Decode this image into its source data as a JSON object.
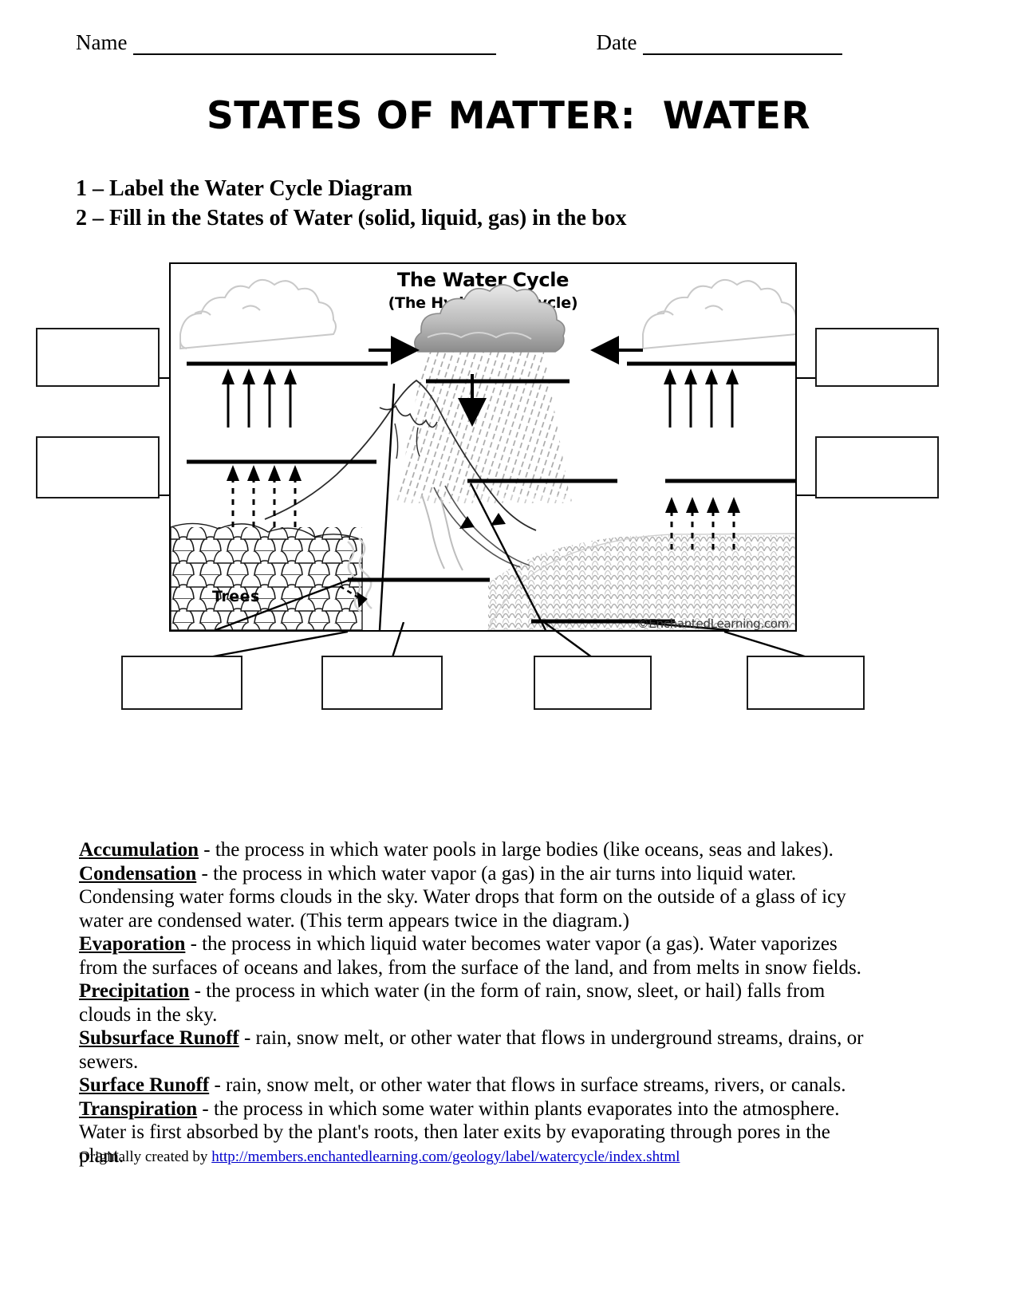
{
  "header": {
    "name_label": "Name",
    "date_label": "Date"
  },
  "title": "STATES OF MATTER:  WATER",
  "instructions": [
    "1 – Label the Water Cycle Diagram",
    "2 – Fill in the States of Water (solid, liquid, gas) in the box"
  ],
  "diagram": {
    "title": "The Water Cycle",
    "subtitle": "(The Hydrologic Cycle)",
    "trees_label": "Trees",
    "copyright": "©EnchantedLearning.com"
  },
  "answer_boxes": [
    {
      "id": "box-left-top",
      "value": ""
    },
    {
      "id": "box-left-bottom",
      "value": ""
    },
    {
      "id": "box-right-top",
      "value": ""
    },
    {
      "id": "box-right-bottom",
      "value": ""
    },
    {
      "id": "box-bottom-1",
      "value": ""
    },
    {
      "id": "box-bottom-2",
      "value": ""
    },
    {
      "id": "box-bottom-3",
      "value": ""
    },
    {
      "id": "box-bottom-4",
      "value": ""
    }
  ],
  "definitions": [
    {
      "term": "Accumulation",
      "text": " - the process in which water pools in large bodies (like oceans, seas and lakes)."
    },
    {
      "term": "Condensation",
      "text": " - the process in which water vapor (a gas) in the air turns into liquid water. Condensing water forms clouds in the sky. Water drops that form on the outside of a glass of icy water are condensed water. (This term appears twice in the diagram.)"
    },
    {
      "term": "Evaporation",
      "text": " - the process in which liquid water becomes water vapor (a gas). Water vaporizes from the surfaces of oceans and lakes, from the surface of the land, and from melts in snow fields."
    },
    {
      "term": "Precipitation",
      "text": " - the process in which water (in the form of rain, snow, sleet, or hail) falls from clouds in the sky."
    },
    {
      "term": "Subsurface Runoff",
      "text": " - rain, snow melt, or other water that flows in underground streams, drains, or sewers."
    },
    {
      "term": "Surface Runoff",
      "text": " - rain, snow melt, or other water that flows in surface streams, rivers, or canals."
    },
    {
      "term": "Transpiration",
      "text": " - the process in which some water within plants evaporates into the atmosphere. Water is first absorbed by the plant's roots, then later exits by evaporating through pores in the plant."
    }
  ],
  "footer": {
    "prefix": "Originally created by ",
    "link": "http://members.enchantedlearning.com/geology/label/watercycle/index.shtml",
    "link_color": "#0000cc"
  }
}
